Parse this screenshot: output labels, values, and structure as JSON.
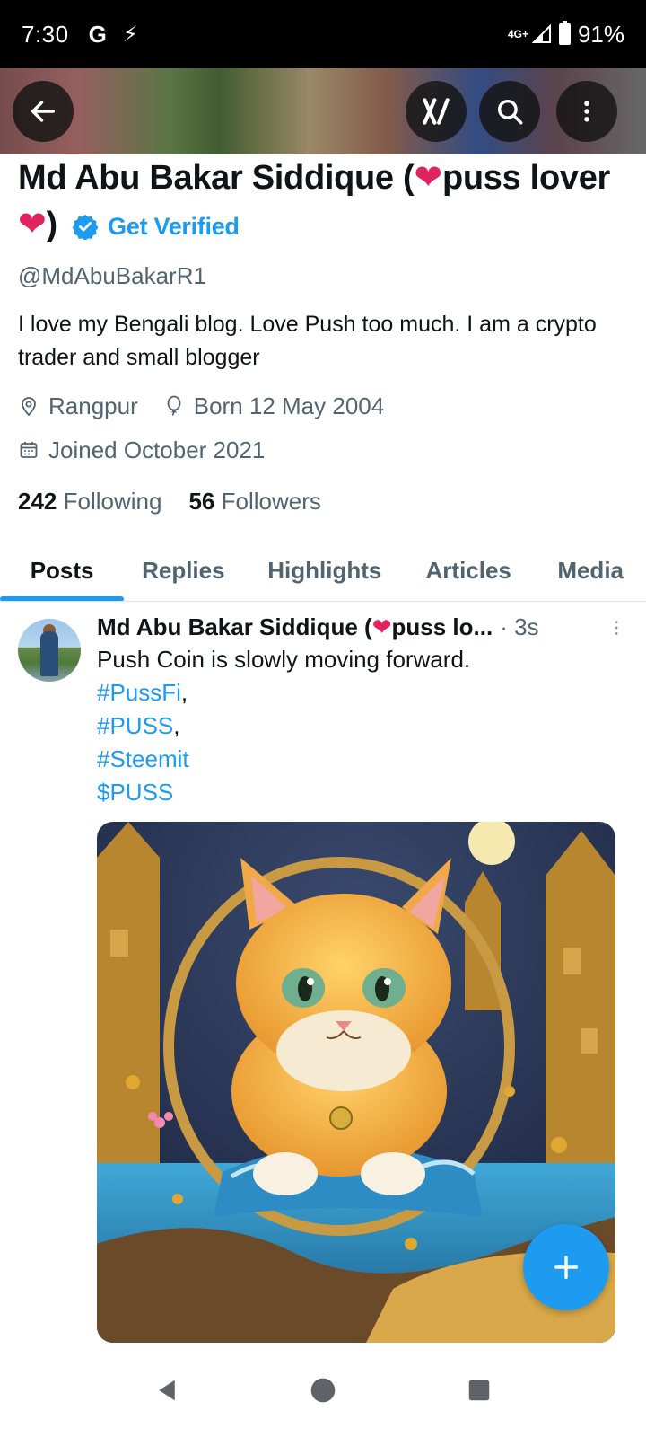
{
  "status_bar": {
    "time": "7:30",
    "left_icons": [
      "google-icon",
      "sync-icon"
    ],
    "network": "4G+",
    "battery": "91%"
  },
  "top_bar": {
    "buttons": [
      "back-arrow-icon",
      "grok-icon",
      "search-icon",
      "more-vertical-icon"
    ]
  },
  "profile": {
    "name_part1": "Md Abu Bakar Siddique (",
    "name_heart1": "❤",
    "name_part2": "puss lover ",
    "name_heart2": "❤",
    "name_part3": ")",
    "get_verified": "Get Verified",
    "handle": "@MdAbuBakarR1",
    "bio": "I love my Bengali blog. Love Push too much. I am a crypto trader and small blogger",
    "location": "Rangpur",
    "born": "Born 12 May 2004",
    "joined": "Joined October 2021",
    "following_count": "242",
    "following_label": "Following",
    "followers_count": "56",
    "followers_label": "Followers"
  },
  "tabs": [
    "Posts",
    "Replies",
    "Highlights",
    "Articles",
    "Media"
  ],
  "active_tab": "Posts",
  "post": {
    "author_part1": "Md Abu Bakar Siddique (",
    "author_heart": "❤",
    "author_part2": "puss lo...",
    "time": "· 3s",
    "text": "Push Coin is slowly moving forward.",
    "tag1": "#PussFi",
    "tag2": "#PUSS",
    "tag3": "#Steemit",
    "tag4": "$PUSS",
    "comma": ","
  },
  "fab": {
    "icon": "plus-icon"
  },
  "nav": [
    "back-triangle-icon",
    "home-circle-icon",
    "recents-square-icon"
  ],
  "colors": {
    "accent": "#1d9bf0",
    "heart": "#e0245e",
    "secondary_text": "#536471"
  }
}
